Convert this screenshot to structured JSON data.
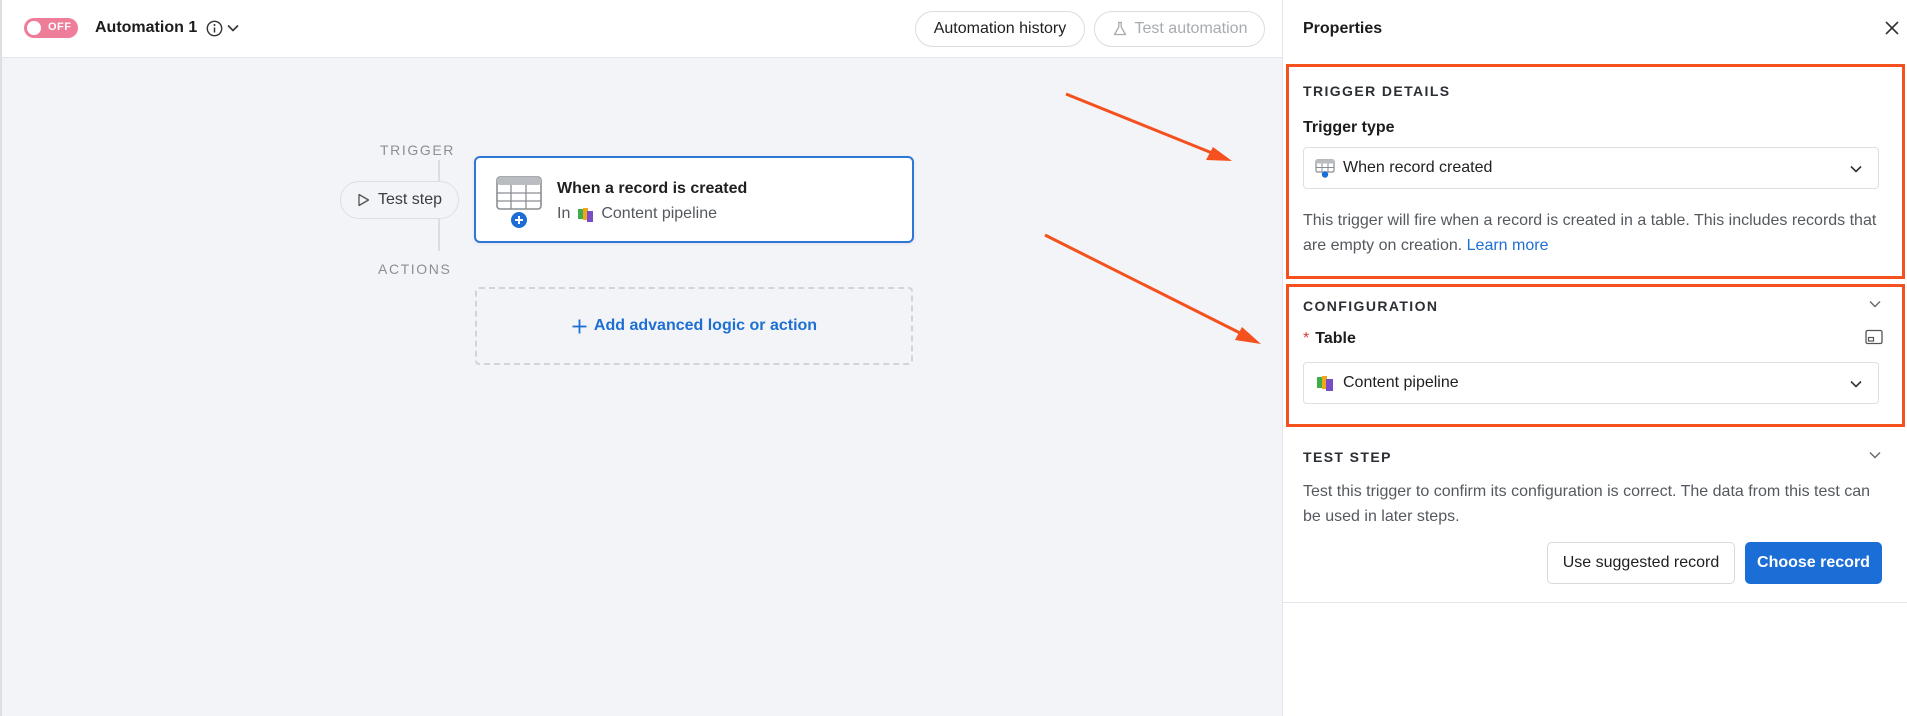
{
  "header": {
    "toggle_label": "OFF",
    "automation_name": "Automation 1",
    "history_button": "Automation history",
    "test_button": "Test automation"
  },
  "canvas": {
    "trigger_label": "TRIGGER",
    "actions_label": "ACTIONS",
    "test_step_button": "Test step",
    "trigger_card": {
      "title": "When a record is created",
      "in_prefix": "In",
      "table_name": "Content pipeline"
    },
    "add_action_label": "Add advanced logic or action"
  },
  "panel": {
    "title": "Properties",
    "trigger_details": {
      "heading": "TRIGGER DETAILS",
      "trigger_type_label": "Trigger type",
      "trigger_type_value": "When record created",
      "description": "This trigger will fire when a record is created in a table. This includes records that are empty on creation.",
      "learn_more": "Learn more"
    },
    "configuration": {
      "heading": "CONFIGURATION",
      "required_mark": "*",
      "table_label": "Table",
      "table_value": "Content pipeline"
    },
    "test_step": {
      "heading": "TEST STEP",
      "description": "Test this trigger to confirm its configuration is correct. The data from this test can be used in later steps.",
      "use_suggested_button": "Use suggested record",
      "choose_record_button": "Choose record"
    }
  },
  "colors": {
    "accent": "#1b6ed6",
    "toggle_off": "#ee7d9a",
    "annotation": "#f4511e",
    "canvas_bg": "#f3f4f7"
  },
  "icons": [
    "info-icon",
    "chevron-down-icon",
    "beaker-icon",
    "play-icon",
    "table-add-icon",
    "base-icon",
    "plus-icon",
    "close-icon",
    "layout-icon"
  ]
}
